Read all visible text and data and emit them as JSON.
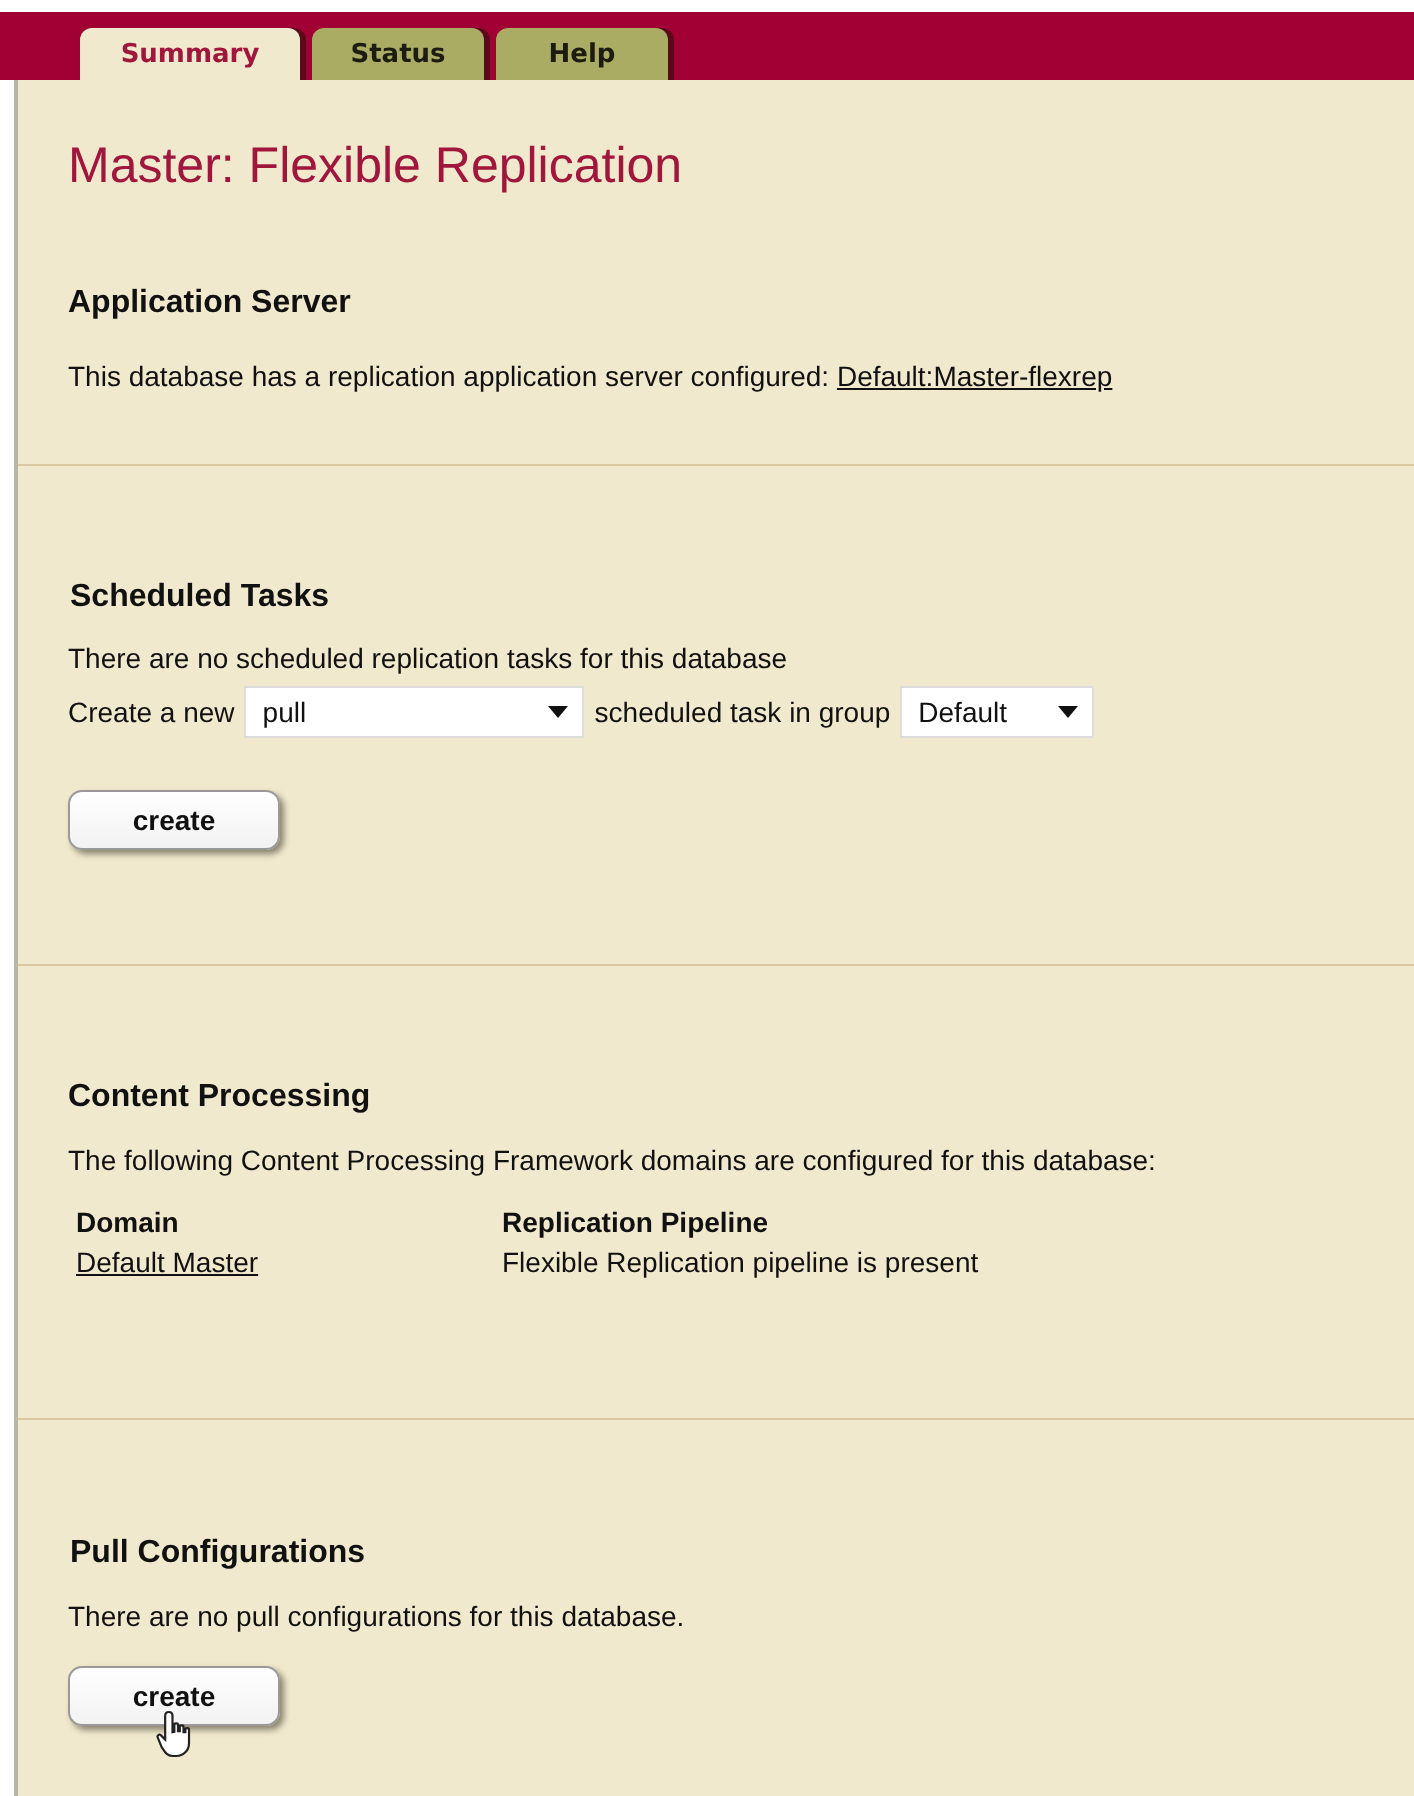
{
  "tabs": [
    {
      "label": "Summary",
      "selected": true
    },
    {
      "label": "Status",
      "selected": false
    },
    {
      "label": "Help",
      "selected": false
    }
  ],
  "title": "Master: Flexible Replication",
  "application_server": {
    "heading": "Application Server",
    "text": "This database has a replication application server configured:",
    "link": "Default:Master-flexrep"
  },
  "scheduled_tasks": {
    "heading": "Scheduled Tasks",
    "text": "There are no scheduled replication tasks for this database",
    "label_before": "Create a new",
    "task_type": "pull",
    "label_after": "scheduled task in group",
    "group": "Default",
    "button": "create"
  },
  "content_processing": {
    "heading": "Content Processing",
    "text": "The following Content Processing Framework domains are configured for this database:",
    "columns": [
      "Domain",
      "Replication Pipeline"
    ],
    "rows": [
      {
        "domain": "Default Master",
        "pipeline": "Flexible Replication pipeline is present"
      }
    ]
  },
  "pull_configurations": {
    "heading": "Pull Configurations",
    "text": "There are no pull configurations for this database.",
    "button": "create"
  }
}
